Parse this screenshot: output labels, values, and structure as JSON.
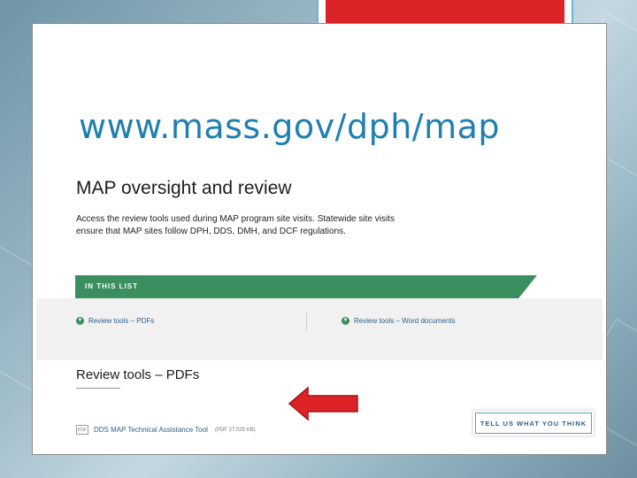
{
  "slide": {
    "title": "www.mass.gov/dph/map"
  },
  "page": {
    "heading": "MAP oversight and review",
    "description": "Access the review tools used during MAP program site visits. Statewide site visits ensure that MAP sites follow DPH, DDS, DMH, and DCF regulations.",
    "list_header": "IN THIS LIST",
    "toc": [
      {
        "label": "Review tools – PDFs"
      },
      {
        "label": "Review tools – Word documents"
      }
    ],
    "section_heading": "Review tools – PDFs",
    "file": {
      "link": "DDS MAP Technical Assistance Tool",
      "meta": "(PDF 27.025 KB)"
    },
    "feedback_button": "TELL US WHAT YOU THINK"
  },
  "colors": {
    "title_blue": "#1f7fb1",
    "band_green": "#3b8f5e",
    "arrow_red": "#dc2328"
  }
}
